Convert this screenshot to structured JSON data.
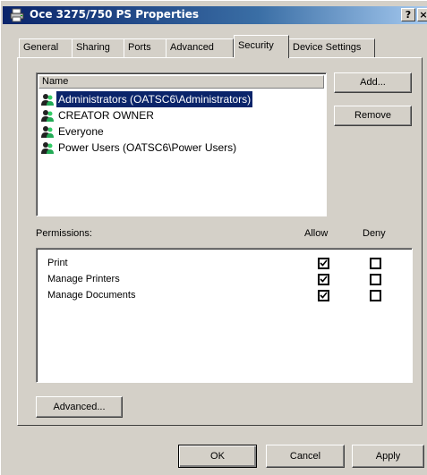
{
  "window": {
    "title": "Oce 3275/750 PS Properties",
    "help_label": "?",
    "close_label": "×"
  },
  "tabs": [
    {
      "label": "General",
      "active": false
    },
    {
      "label": "Sharing",
      "active": false
    },
    {
      "label": "Ports",
      "active": false
    },
    {
      "label": "Advanced",
      "active": false
    },
    {
      "label": "Security",
      "active": true
    },
    {
      "label": "Device Settings",
      "active": false
    }
  ],
  "security": {
    "name_header": "Name",
    "users": [
      {
        "label": "Administrators (OATSC6\\Administrators)",
        "selected": true,
        "icon": "group-icon"
      },
      {
        "label": "CREATOR OWNER",
        "selected": false,
        "icon": "group-icon"
      },
      {
        "label": "Everyone",
        "selected": false,
        "icon": "group-icon"
      },
      {
        "label": "Power Users (OATSC6\\Power Users)",
        "selected": false,
        "icon": "group-icon"
      }
    ],
    "add_label": "Add...",
    "remove_label": "Remove",
    "permissions_label": "Permissions:",
    "allow_header": "Allow",
    "deny_header": "Deny",
    "permissions": [
      {
        "label": "Print",
        "allow": true,
        "deny": false
      },
      {
        "label": "Manage Printers",
        "allow": true,
        "deny": false
      },
      {
        "label": "Manage Documents",
        "allow": true,
        "deny": false
      }
    ],
    "advanced_label": "Advanced..."
  },
  "footer": {
    "ok_label": "OK",
    "cancel_label": "Cancel",
    "apply_label": "Apply"
  },
  "colors": {
    "title_bar": "#0a246a",
    "selection": "#0a246a",
    "face": "#d4d0c8"
  }
}
